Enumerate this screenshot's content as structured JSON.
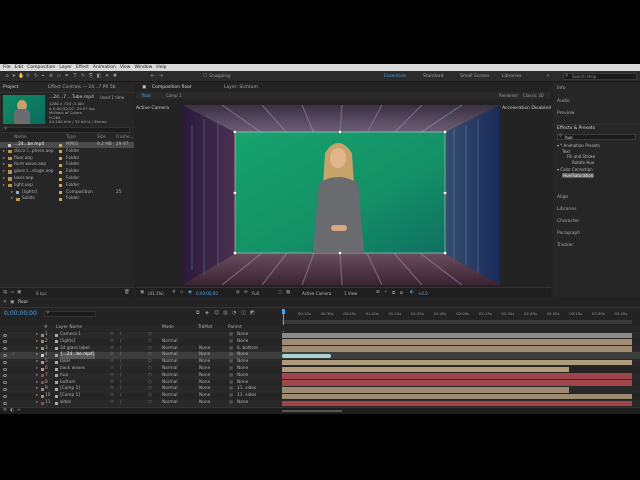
{
  "menubar": [
    "File",
    "Edit",
    "Composition",
    "Layer",
    "Effect",
    "Animation",
    "View",
    "Window",
    "Help"
  ],
  "toolbar": {
    "snapping": "Snapping",
    "workspaces": [
      {
        "label": "Essentials",
        "active": true
      },
      {
        "label": "Standard",
        "active": false
      },
      {
        "label": "Small Screen",
        "active": false
      },
      {
        "label": "Libraries",
        "active": false
      }
    ],
    "search_placeholder": "Search Help"
  },
  "project": {
    "tab": "Project",
    "effect_controls": "Effect Controls — 24...7 PR 5b",
    "selected_name": "...24...7 ...Tube.mp4",
    "selected_used": "Used 1 time",
    "info": [
      "1280 x 720 (1.00)",
      "Δ 0;00;52;07, 29.97 fps",
      "Millions of Colors",
      "H.264",
      "44.100 kHz / 32 bit U / Stereo"
    ],
    "search_placeholder": "",
    "columns": {
      "name": "Name",
      "type": "Type",
      "size": "Size",
      "fps": "Frame..."
    },
    "items": [
      {
        "name": "...24...be.mp4",
        "type": "MPEG",
        "size": "9.2 MB",
        "fps": "29.97",
        "color": "#c9a84e",
        "selected": true
      },
      {
        "name": "disco l...phere.aep",
        "type": "Folder",
        "size": "",
        "fps": "",
        "color": "#c9a84e",
        "selected": false
      },
      {
        "name": "floor.aep",
        "type": "Folder",
        "size": "",
        "fps": "",
        "color": "#c9a84e",
        "selected": false
      },
      {
        "name": "form wave.aep",
        "type": "Folder",
        "size": "",
        "fps": "",
        "color": "#c9a84e",
        "selected": false
      },
      {
        "name": "glass t...stage.aep",
        "type": "Folder",
        "size": "",
        "fps": "",
        "color": "#c9a84e",
        "selected": false
      },
      {
        "name": "laser.aep",
        "type": "Folder",
        "size": "",
        "fps": "",
        "color": "#c9a84e",
        "selected": false
      },
      {
        "name": "light.aep",
        "type": "Folder",
        "size": "",
        "fps": "",
        "color": "#c9a84e",
        "selected": false
      },
      {
        "name": "[lights]",
        "type": "Composition",
        "size": "",
        "fps": "25",
        "color": "#c9a84e",
        "selected": false
      },
      {
        "name": "Solids",
        "type": "Folder",
        "size": "",
        "fps": "",
        "color": "#c9a84e",
        "selected": false
      }
    ],
    "footer": "8 bpc"
  },
  "composition": {
    "tabs": [
      "Composition floor",
      "Layer: Sichtum"
    ],
    "sub_tabs": [
      "floor",
      "Comp 1"
    ],
    "renderer": "Renderer:",
    "renderer_value": "Classic 3D",
    "camera_label": "Active Camera",
    "accel_notice": "Display Acceleration Disabled",
    "footer": {
      "zoom": "(41.1%)",
      "timecode": "0;00;00;00",
      "quality": "Full",
      "camera": "Active Camera",
      "views": "1 View",
      "exposure": "+0.0"
    }
  },
  "right_panel": {
    "items": [
      "Info",
      "Audio",
      "Preview"
    ],
    "effects_title": "Effects & Presets",
    "effects_search": "hue",
    "tree": [
      {
        "label": "* Animation Presets",
        "indent": 0
      },
      {
        "label": "Text",
        "indent": 1
      },
      {
        "label": "Fill and Stroke",
        "indent": 2
      },
      {
        "label": "Rotate Hue",
        "indent": 3
      },
      {
        "label": "Color Correction",
        "indent": 0
      },
      {
        "label": "Hue/Saturation",
        "indent": 1,
        "highlight": true
      }
    ],
    "lower_items": [
      "Align",
      "Libraries",
      "Character",
      "Paragraph",
      "Tracker"
    ]
  },
  "timeline": {
    "tab": "floor",
    "timecode": "0;00;00;00",
    "search_placeholder": "",
    "columns": {
      "num": "#",
      "name": "Layer Name",
      "mode": "Mode",
      "trkmat": "TrkMat",
      "parent": "Parent"
    },
    "ruler": [
      "00:15s",
      "00:30s",
      "00:45s",
      "01:00s",
      "01:15s",
      "01:30s",
      "01:45s",
      "02:00s",
      "02:15s",
      "02:30s",
      "02:45s",
      "03:00s",
      "03:15s",
      "03:30s",
      "03:45s"
    ],
    "layers": [
      {
        "num": "1",
        "name": "Camera 1",
        "mode": "",
        "trkmat": "",
        "parent": "None",
        "bar": "#8a8a8a",
        "start": 0.0,
        "end": 1.0
      },
      {
        "num": "2",
        "name": "[lights]",
        "mode": "Normal",
        "trkmat": "",
        "parent": "None",
        "bar": "#a08c74",
        "start": 0.0,
        "end": 1.0
      },
      {
        "num": "3",
        "name": "3d glass label",
        "mode": "Normal",
        "trkmat": "None",
        "parent": "6. bottom",
        "bar": "#a08c74",
        "start": 0.0,
        "end": 1.0
      },
      {
        "num": "4",
        "name": "[...24...be.mp4]",
        "mode": "Normal",
        "trkmat": "None",
        "parent": "None",
        "bar": "#a9d3d0",
        "start": 0.0,
        "end": 0.14,
        "selected": true
      },
      {
        "num": "5",
        "name": "laser",
        "mode": "Normal",
        "trkmat": "None",
        "parent": "None",
        "bar": "#b09b7a",
        "start": 0.0,
        "end": 1.0
      },
      {
        "num": "6",
        "name": "back waves",
        "mode": "Normal",
        "trkmat": "None",
        "parent": "None",
        "bar": "#b09b7a",
        "start": 0.0,
        "end": 0.82
      },
      {
        "num": "7",
        "name": "hue",
        "mode": "Normal",
        "trkmat": "None",
        "parent": "None",
        "bar": "#a0454a",
        "start": 0.0,
        "end": 1.0
      },
      {
        "num": "8",
        "name": "bottom",
        "mode": "Normal",
        "trkmat": "None",
        "parent": "None",
        "bar": "#a0454a",
        "start": 0.0,
        "end": 1.0
      },
      {
        "num": "9",
        "name": "[Comp 1]",
        "mode": "Normal",
        "trkmat": "None",
        "parent": "11. sides",
        "bar": "#9c8a72",
        "start": 0.0,
        "end": 0.82
      },
      {
        "num": "10",
        "name": "[Comp 1]",
        "mode": "Normal",
        "trkmat": "None",
        "parent": "11. sides",
        "bar": "#9c8a72",
        "start": 0.0,
        "end": 1.0
      },
      {
        "num": "11",
        "name": "sides",
        "mode": "Normal",
        "trkmat": "None",
        "parent": "None",
        "bar": "#a0454a",
        "start": 0.0,
        "end": 1.0
      }
    ]
  },
  "colors": {
    "accent": "#2d8ceb",
    "selection": "#4a9ee8",
    "timecode": "#4aa3f0"
  }
}
